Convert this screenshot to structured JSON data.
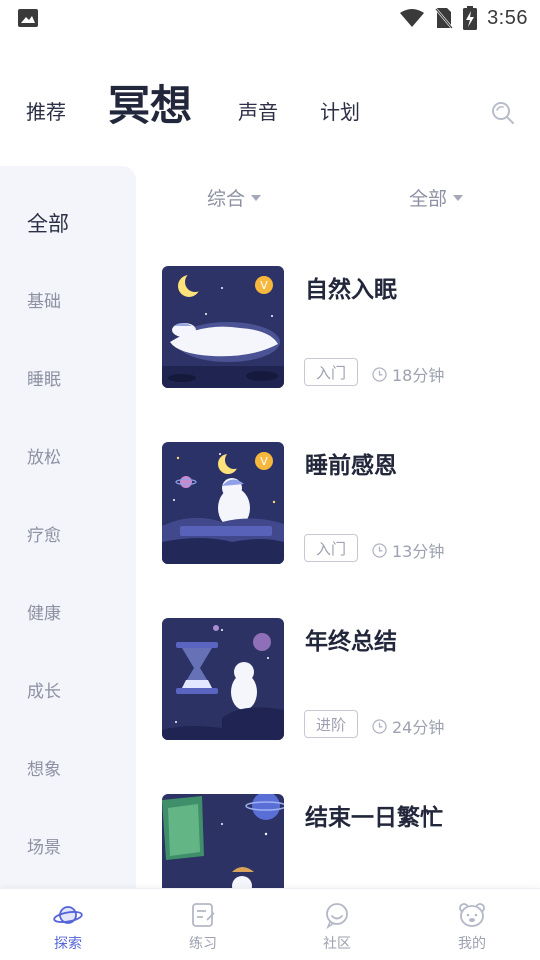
{
  "status_bar": {
    "time": "3:56"
  },
  "top_tabs": {
    "recommend": "推荐",
    "meditation": "冥想",
    "sound": "声音",
    "plan": "计划"
  },
  "sidebar": {
    "items": [
      {
        "label": "全部",
        "active": true
      },
      {
        "label": "基础"
      },
      {
        "label": "睡眠"
      },
      {
        "label": "放松"
      },
      {
        "label": "疗愈"
      },
      {
        "label": "健康"
      },
      {
        "label": "成长"
      },
      {
        "label": "想象"
      },
      {
        "label": "场景"
      }
    ]
  },
  "filters": {
    "sort": "综合",
    "category": "全部"
  },
  "courses": [
    {
      "title": "自然入眠",
      "level": "入门",
      "duration": "18分钟",
      "vip": true
    },
    {
      "title": "睡前感恩",
      "level": "入门",
      "duration": "13分钟",
      "vip": true
    },
    {
      "title": "年终总结",
      "level": "进阶",
      "duration": "24分钟",
      "vip": false
    },
    {
      "title": "结束一日繁忙",
      "level": "",
      "duration": "",
      "vip": false
    }
  ],
  "bottom_nav": {
    "explore": "探索",
    "practice": "练习",
    "community": "社区",
    "mine": "我的"
  },
  "colors": {
    "accent": "#5564d8",
    "highlight": "#c9d0f4",
    "sidebar_bg": "#f3f5fa"
  }
}
